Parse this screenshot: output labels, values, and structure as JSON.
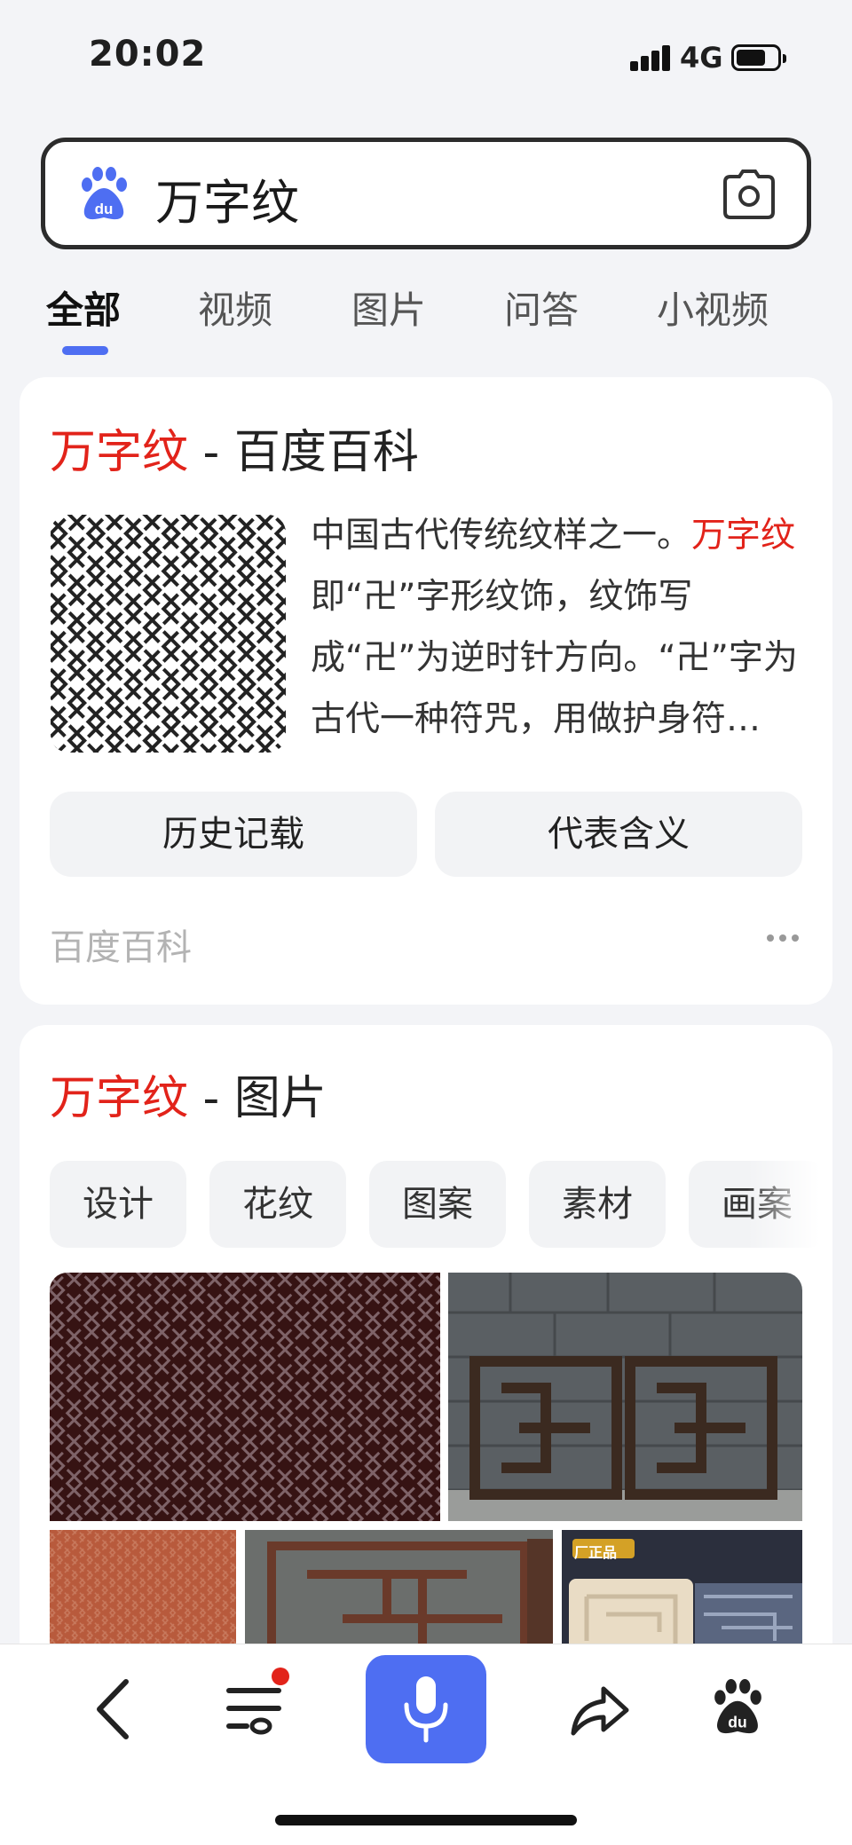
{
  "status_bar": {
    "time": "20:02",
    "network": "4G"
  },
  "search": {
    "query": "万字纹",
    "logo_icon": "baidu-paw-logo",
    "camera_icon": "camera-icon"
  },
  "tabs": [
    {
      "label": "全部",
      "active": true
    },
    {
      "label": "视频",
      "active": false
    },
    {
      "label": "图片",
      "active": false
    },
    {
      "label": "问答",
      "active": false
    },
    {
      "label": "小视频",
      "active": false
    }
  ],
  "baike_card": {
    "title_highlight": "万字纹",
    "title_rest": " - 百度百科",
    "summary_before": "中国古代传统纹样之一。",
    "summary_highlight": "万字纹",
    "summary_after": "即“卍”字形纹饰，纹饰写成“卍”为逆时针方向。“卍”字为古代一种符咒，用做护身符…",
    "buttons": [
      "历史记载",
      "代表含义"
    ],
    "source": "百度百科"
  },
  "image_card": {
    "title_highlight": "万字纹",
    "title_rest": " - 图片",
    "chips": [
      "设计",
      "花纹",
      "图案",
      "素材",
      "画案"
    ],
    "tile_text": "厂正品"
  },
  "colors": {
    "accent": "#4e6ef2",
    "highlight": "#e2231a",
    "background": "#f3f4f7"
  },
  "bottom_nav": {
    "icons": [
      "back-arrow-icon",
      "menu-list-icon",
      "microphone-icon",
      "share-icon",
      "baidu-paw-icon"
    ],
    "has_notification_dot": true
  }
}
